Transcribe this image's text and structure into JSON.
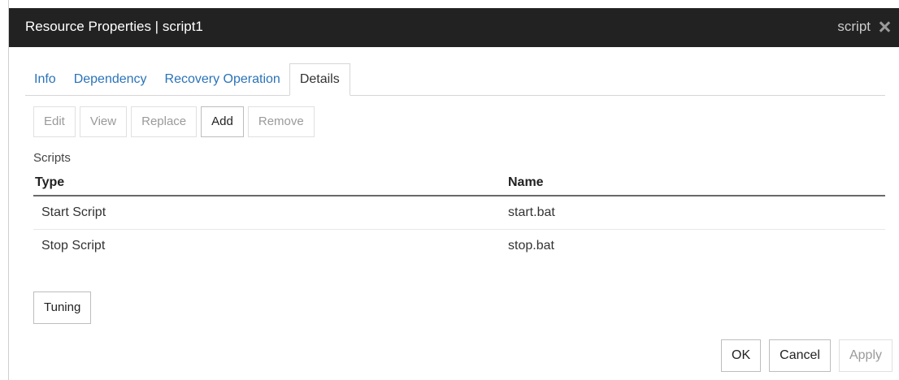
{
  "dialog": {
    "title": "Resource Properties | script1",
    "type_label": "script"
  },
  "tabs": [
    {
      "label": "Info",
      "active": false
    },
    {
      "label": "Dependency",
      "active": false
    },
    {
      "label": "Recovery Operation",
      "active": false
    },
    {
      "label": "Details",
      "active": true
    }
  ],
  "toolbar": {
    "edit": "Edit",
    "view": "View",
    "replace": "Replace",
    "add": "Add",
    "remove": "Remove"
  },
  "scripts": {
    "section_label": "Scripts",
    "columns": {
      "type": "Type",
      "name": "Name"
    },
    "rows": [
      {
        "type": "Start Script",
        "name": "start.bat"
      },
      {
        "type": "Stop Script",
        "name": "stop.bat"
      }
    ]
  },
  "tuning_label": "Tuning",
  "footer": {
    "ok": "OK",
    "cancel": "Cancel",
    "apply": "Apply"
  },
  "colors": {
    "titlebar": "#222222",
    "tab_link": "#2a73b8",
    "disabled_text": "#9a9a9a"
  }
}
